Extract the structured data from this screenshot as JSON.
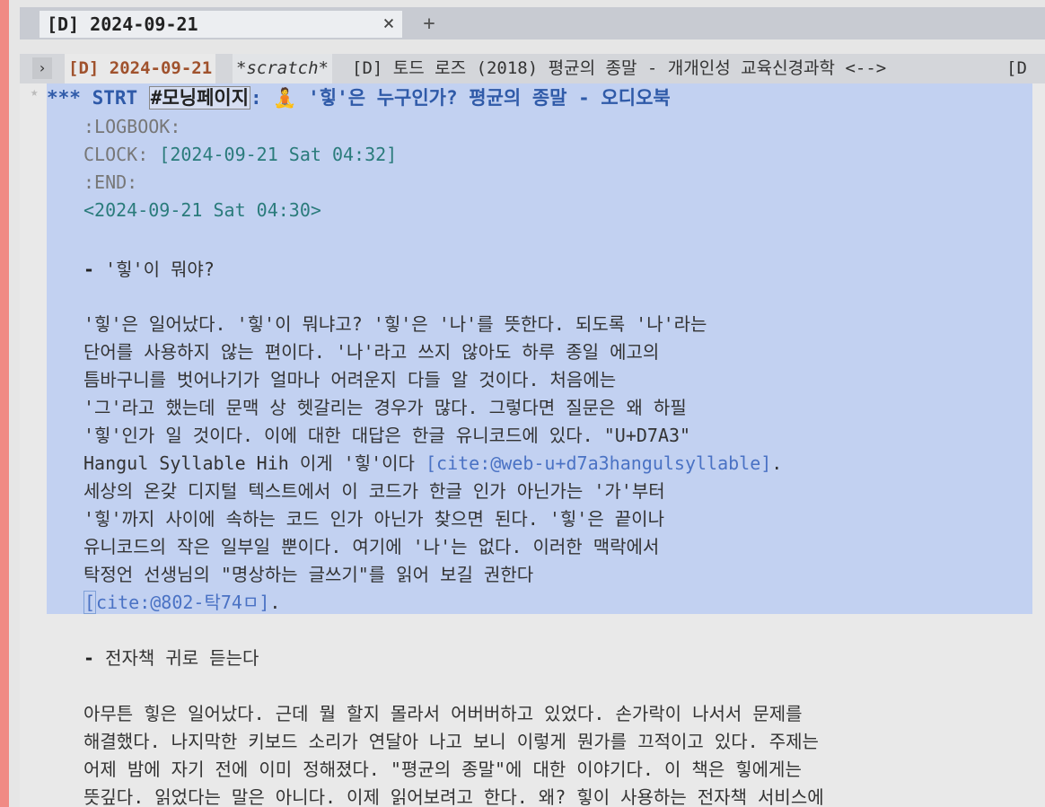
{
  "tabs": {
    "active_title": "[D] 2024-09-21",
    "close_glyph": "×",
    "new_glyph": "+"
  },
  "buffers": {
    "arrow": "›",
    "items": [
      "[D] 2024-09-21",
      "*scratch*",
      "[D] 토드 로즈 (2018) 평균의 종말 - 개개인성 교육신경과학 <-->",
      "[D"
    ]
  },
  "doc": {
    "heading_stars": "*** STRT ",
    "heading_tag": "#모닝페이지",
    "heading_rest": ": 🧘 '힣'은 누구인가? 평균의 종말 - 오디오북",
    "logbook": ":LOGBOOK:",
    "clock_label": "CLOCK: ",
    "clock_ts": "[2024-09-21 Sat 04:32]",
    "end": ":END:",
    "scheduled": "<2024-09-21 Sat 04:30>",
    "bullet1": "- ",
    "bullet1_text": "'힣'이 뭐야?",
    "para1": [
      "'힣'은 일어났다. '힣'이 뭐냐고? '힣'은 '나'를 뜻한다. 되도록 '나'라는",
      "단어를 사용하지 않는 편이다. '나'라고 쓰지 않아도 하루 종일 에고의",
      "틈바구니를 벗어나기가 얼마나 어려운지 다들 알 것이다. 처음에는",
      "'그'라고 했는데 문맥 상 헷갈리는 경우가 많다. 그렇다면 질문은 왜 하필",
      "'힣'인가 일 것이다. 이에 대한 대답은 한글 유니코드에 있다. \"U+D7A3\""
    ],
    "para1_line6_pre": "Hangul Syllable Hih 이게 '힣'이다 ",
    "para1_cite1": "[cite:@web-u+d7a3hangulsyllable]",
    "para1_line6_post": ".",
    "para1b": [
      "세상의 온갖 디지털 텍스트에서 이 코드가 한글 인가 아닌가는 '가'부터",
      "'힣'까지 사이에 속하는 코드 인가 아닌가 찾으면 된다. '힣'은 끝이나",
      "유니코드의 작은 일부일 뿐이다. 여기에 '나'는 없다. 이러한 맥락에서",
      "탁정언 선생님의 \"명상하는 글쓰기\"를 읽어 보길 권한다"
    ],
    "para1_cite2_open": "[",
    "para1_cite2": "cite:@802-탁74ㅁ]",
    "para1_cite2_post": ".",
    "bullet2": "- ",
    "bullet2_text": "전자책 귀로 듣는다",
    "para2": [
      "아무튼 힣은 일어났다. 근데 뭘 할지 몰라서 어버버하고 있었다. 손가락이 나서서 문제를",
      "해결했다. 나지막한 키보드 소리가 연달아 나고 보니 이렇게 뭔가를 끄적이고 있다. 주제는",
      "어제 밤에 자기 전에 이미 정해졌다. \"평균의 종말\"에 대한 이야기다. 이 책은 힣에게는",
      "뜻깊다. 읽었다는 말은 아니다. 이제 읽어보려고 한다. 왜? 힣이 사용하는 전자책 서비스에"
    ]
  }
}
